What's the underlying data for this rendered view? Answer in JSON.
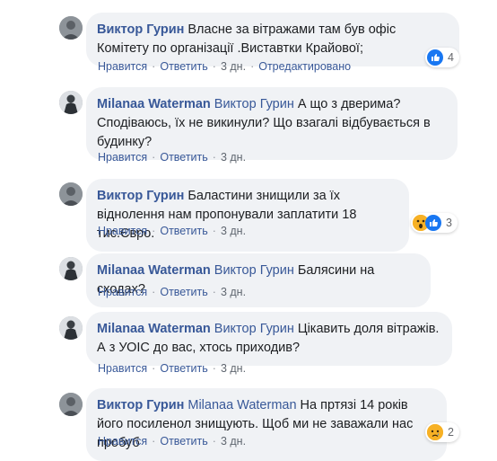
{
  "actions": {
    "like": "Нравится",
    "reply": "Ответить",
    "edited": "Отредактировано",
    "sep": "·"
  },
  "comments": [
    {
      "author": "Виктор Гурин",
      "mention": "",
      "text": "Власне за вітражами там був офіс Комітету по організації .Виставтки Крайової;",
      "time": "3 дн.",
      "edited": true,
      "reaction": "like",
      "reaction_count": "4"
    },
    {
      "author": "Milanaa Waterman",
      "mention": "Виктор Гурин",
      "text": "А що з дверима? Сподіваюсь, їх не викинули? Що взагалі відбувається в будинку?",
      "time": "3 дн.",
      "edited": false,
      "reaction": "",
      "reaction_count": ""
    },
    {
      "author": "Виктор Гурин",
      "mention": "",
      "text": "Баластини знищили за їх віднолення нам пропонували заплатити 18 тис.Євро.",
      "time": "3 дн.",
      "edited": false,
      "reaction": "wow-like",
      "reaction_count": "3"
    },
    {
      "author": "Milanaa Waterman",
      "mention": "Виктор Гурин",
      "text": "Балясини на сходах?",
      "time": "3 дн.",
      "edited": false,
      "reaction": "",
      "reaction_count": ""
    },
    {
      "author": "Milanaa Waterman",
      "mention": "Виктор Гурин",
      "text": "Цікавить доля вітражів. А з УОІС до вас, хтось приходив?",
      "time": "3 дн.",
      "edited": false,
      "reaction": "",
      "reaction_count": ""
    },
    {
      "author": "Виктор Гурин",
      "mention": "Milanaa Waterman",
      "text": "На пртязі 14 років його посиленол знищують. Щоб ми не заважали нас пробуб",
      "time": "3 дн.",
      "edited": false,
      "reaction": "sad",
      "reaction_count": "2"
    }
  ]
}
